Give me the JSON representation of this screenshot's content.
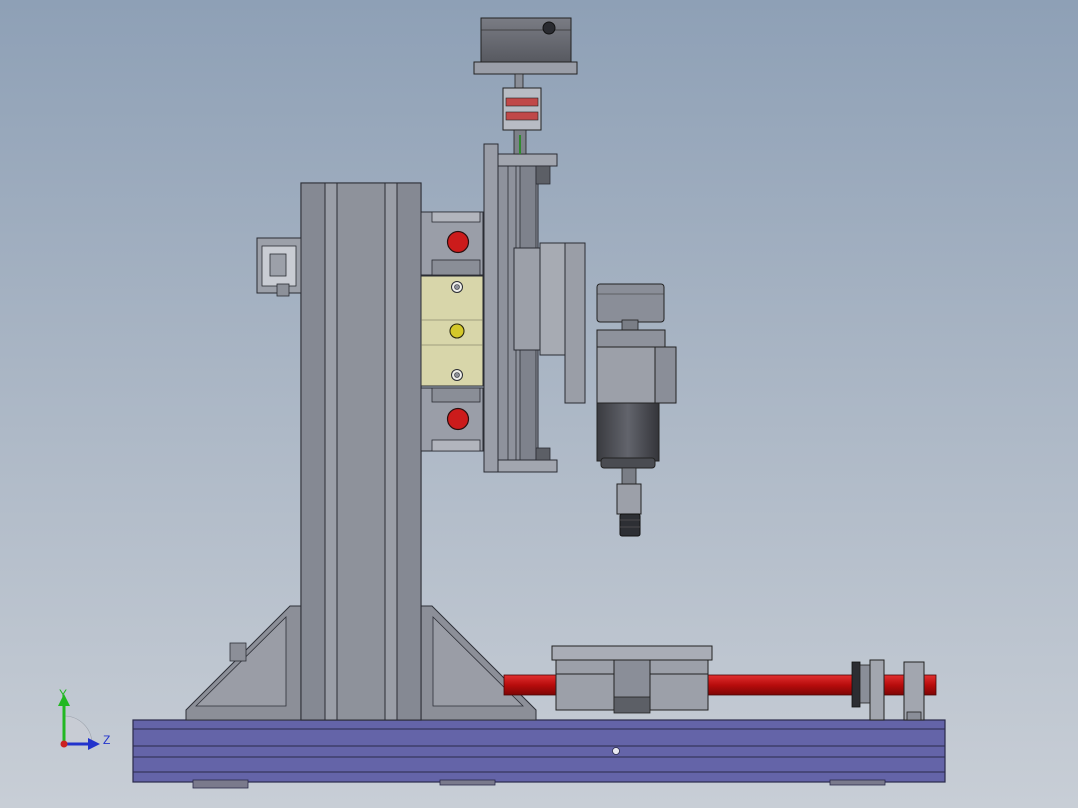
{
  "triad": {
    "y_label": "Y",
    "z_label": "Z",
    "colors": {
      "y": "#22b822",
      "z": "#2233cc",
      "origin": "#cc2222"
    }
  },
  "colors": {
    "background_top": "#8ea0b6",
    "background_bottom": "#c8ced6",
    "frame_gray": "#8a8f9a",
    "base_blue": "#6a6aaa",
    "lead_screw_red": "#cc1111",
    "spindle_dark": "#4a4c52",
    "clamp_plate": "#d6d4a8",
    "red_knob": "#cc1b1b",
    "yellow_bolt": "#d4c82a"
  }
}
